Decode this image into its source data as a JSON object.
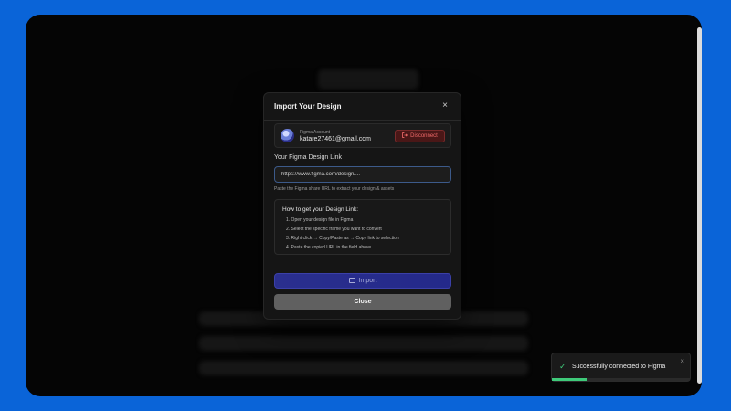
{
  "modal": {
    "title": "Import Your Design",
    "close_glyph": "×",
    "account": {
      "label": "Figma Account",
      "email": "katare27461@gmail.com",
      "disconnect_label": "Disconnect",
      "disconnect_icon": "logout-icon"
    },
    "link_field": {
      "label": "Your Figma Design Link",
      "value": "https://www.figma.com/design/...",
      "hint": "Paste the Figma share URL to extract your design & assets"
    },
    "howto": {
      "title": "How to get your Design Link:",
      "steps": [
        "1. Open your design file in Figma",
        "2. Select the specific frame you want to convert",
        "3. Right click → Copy/Paste as → Copy link to selection",
        "4. Paste the copied URL in the field above"
      ]
    },
    "import_label": "Import",
    "close_label": "Close"
  },
  "toast": {
    "check_glyph": "✓",
    "message": "Successfully connected to Figma",
    "close_glyph": "×",
    "progress": 0.25
  },
  "colors": {
    "outer_background": "#0a64d8",
    "import_button": "#2a2f8e",
    "disconnect": "#f06a6a",
    "success": "#3fca7a"
  }
}
